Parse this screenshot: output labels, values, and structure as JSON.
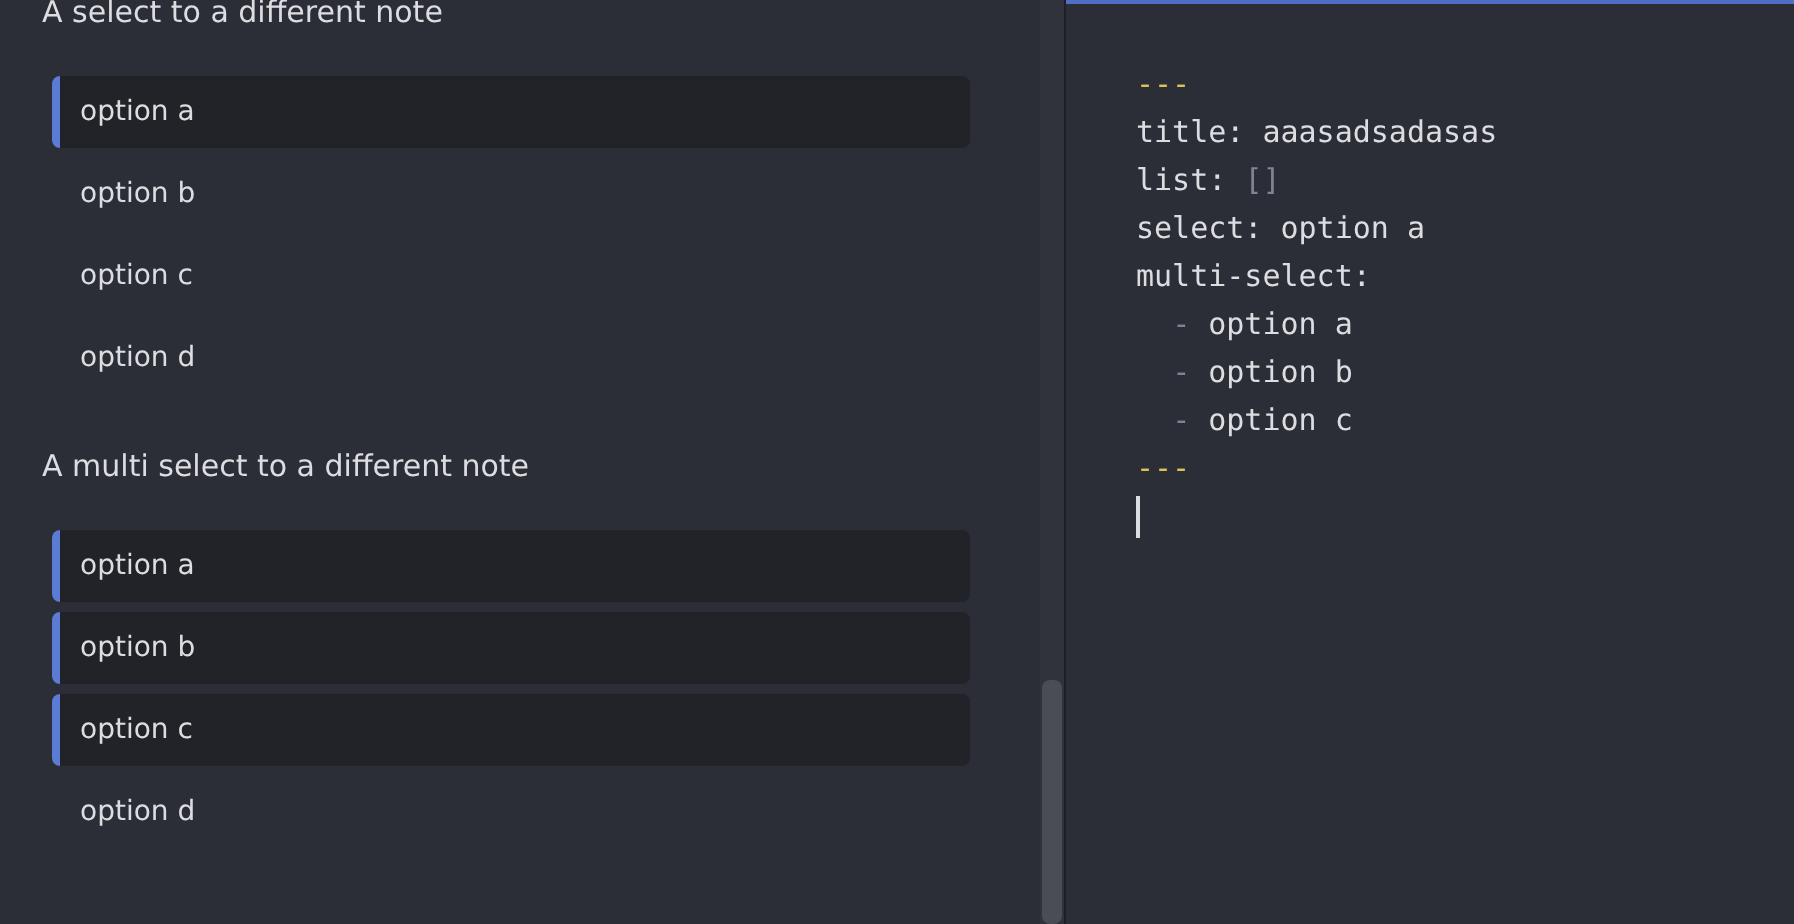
{
  "form": {
    "sections": [
      {
        "heading": "A select to a different note",
        "options": [
          {
            "label": "option a",
            "selected": true
          },
          {
            "label": "option b",
            "selected": false
          },
          {
            "label": "option c",
            "selected": false
          },
          {
            "label": "option d",
            "selected": false
          }
        ]
      },
      {
        "heading": "A multi select to a different note",
        "options": [
          {
            "label": "option a",
            "selected": true
          },
          {
            "label": "option b",
            "selected": true
          },
          {
            "label": "option c",
            "selected": true
          },
          {
            "label": "option d",
            "selected": false
          }
        ]
      }
    ]
  },
  "source": {
    "lines": [
      {
        "kind": "delimiter",
        "text": "---"
      },
      {
        "kind": "field",
        "key": "title:",
        "value": "aaasadsadasas",
        "muted": false
      },
      {
        "kind": "field",
        "key": "list:",
        "value": "[]",
        "muted": true
      },
      {
        "kind": "field",
        "key": "select:",
        "value": "option a",
        "muted": false
      },
      {
        "kind": "field",
        "key": "multi-select:"
      },
      {
        "kind": "list-item",
        "marker": "-",
        "value": "option a"
      },
      {
        "kind": "list-item",
        "marker": "-",
        "value": "option b"
      },
      {
        "kind": "list-item",
        "marker": "-",
        "value": "option c"
      },
      {
        "kind": "delimiter",
        "text": "---"
      }
    ]
  }
}
